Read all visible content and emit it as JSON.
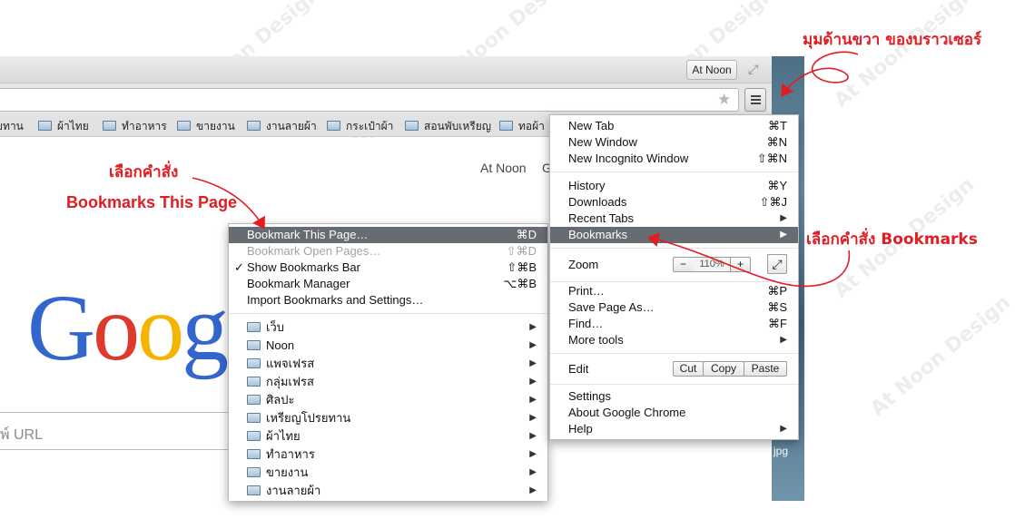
{
  "titlebar": {
    "profile_label": "At Noon"
  },
  "bookmarks_bar": {
    "items": [
      "ยทาน",
      "ผ้าไทย",
      "ทำอาหาร",
      "ขายงาน",
      "งานลายผ้า",
      "กระเป๋าผ้า",
      "สอนพับเหรียญ",
      "ทอผ้า"
    ]
  },
  "page": {
    "user_name": "At Noon",
    "user_extra": "G",
    "logo_letters": [
      "G",
      "o",
      "o",
      "g"
    ],
    "search_hint": "พ์ URL"
  },
  "desktop": {
    "file_label": "jpg"
  },
  "chrome_menu": {
    "items": [
      {
        "label": "New Tab",
        "shortcut": "⌘T"
      },
      {
        "label": "New Window",
        "shortcut": "⌘N"
      },
      {
        "label": "New Incognito Window",
        "shortcut": "⇧⌘N"
      },
      {
        "label": "History",
        "shortcut": "⌘Y"
      },
      {
        "label": "Downloads",
        "shortcut": "⇧⌘J"
      },
      {
        "label": "Recent Tabs",
        "shortcut": "▶"
      },
      {
        "label": "Bookmarks",
        "shortcut": "▶"
      },
      {
        "label": "Zoom",
        "shortcut": ""
      },
      {
        "label": "Print…",
        "shortcut": "⌘P"
      },
      {
        "label": "Save Page As…",
        "shortcut": "⌘S"
      },
      {
        "label": "Find…",
        "shortcut": "⌘F"
      },
      {
        "label": "More tools",
        "shortcut": "▶"
      },
      {
        "label": "Edit",
        "shortcut": ""
      },
      {
        "label": "Settings",
        "shortcut": ""
      },
      {
        "label": "About Google Chrome",
        "shortcut": ""
      },
      {
        "label": "Help",
        "shortcut": "▶"
      }
    ],
    "zoom": {
      "minus": "−",
      "value": "110%",
      "plus": "+"
    },
    "edit": {
      "cut": "Cut",
      "copy": "Copy",
      "paste": "Paste"
    }
  },
  "bookmarks_submenu": {
    "items": [
      {
        "label": "Bookmark This Page…",
        "shortcut": "⌘D"
      },
      {
        "label": "Bookmark Open Pages…",
        "shortcut": "⇧⌘D"
      },
      {
        "label": "Show Bookmarks Bar",
        "shortcut": "⇧⌘B",
        "check": "✓"
      },
      {
        "label": "Bookmark Manager",
        "shortcut": "⌥⌘B"
      },
      {
        "label": "Import Bookmarks and Settings…",
        "shortcut": ""
      }
    ],
    "folders": [
      "เว็บ",
      "Noon",
      "แพจเฟรส",
      "กลุ่มเฟรส",
      "ศิลปะ",
      "เหรียญโปรยทาน",
      "ผ้าไทย",
      "ทำอาหาร",
      "ขายงาน",
      "งานลายผ้า"
    ]
  },
  "annotations": {
    "browser_corner": "มุมด้านขวา ของบราวเซอร์",
    "select_command": "เลือกคำสั่ง",
    "bookmarks_this_page": "Bookmarks This Page",
    "select_bookmarks": "เลือกคำสั่ง Bookmarks"
  },
  "watermark": "At Noon Design",
  "colors": {
    "annotation": "#e11d24",
    "highlight": "#676c73"
  }
}
